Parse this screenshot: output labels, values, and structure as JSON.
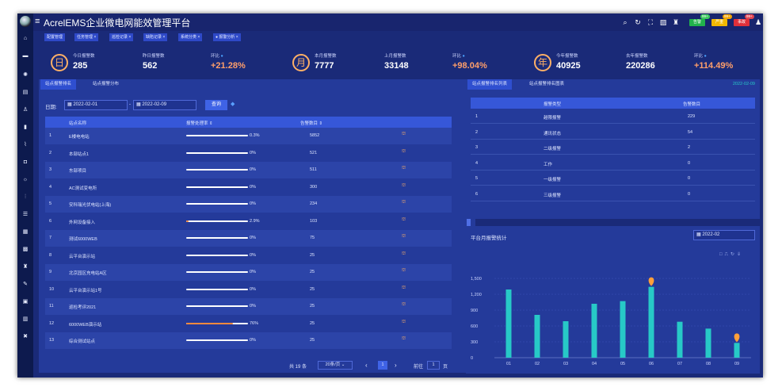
{
  "app": {
    "title": "AcrelEMS企业微电网能效管理平台"
  },
  "topbar": {
    "badges": [
      {
        "label": "告警",
        "count": "99+",
        "color": "#22b24c",
        "count_color": "#3cc85c"
      },
      {
        "label": "严重",
        "count": "99+",
        "color": "#f2b800",
        "count_color": "#f2a400"
      },
      {
        "label": "事故",
        "count": "99+",
        "color": "#e0303a",
        "count_color": "#e04450"
      }
    ],
    "icons": [
      "search-icon",
      "refresh-icon",
      "fullscreen-icon",
      "image-icon",
      "shirt-icon",
      "user-icon"
    ]
  },
  "nav_tabs": [
    "配置管理",
    "任务管理 ×",
    "巡检记录 ×",
    "缺陷记录 ×",
    "系统分类 ×",
    "● 报警分析 ×"
  ],
  "kpis": [
    {
      "circle": "日",
      "today_label": "今日报警数",
      "today_value": "285",
      "prev_label": "昨日报警数",
      "prev_value": "562",
      "ratio_label": "环比",
      "ratio_value": "+21.28%"
    },
    {
      "circle": "月",
      "today_label": "本月报警数",
      "today_value": "7777",
      "prev_label": "上月报警数",
      "prev_value": "33148",
      "ratio_label": "环比",
      "ratio_value": "+98.04%"
    },
    {
      "circle": "年",
      "today_label": "今年报警数",
      "today_value": "40925",
      "prev_label": "去年报警数",
      "prev_value": "220286",
      "ratio_label": "环比",
      "ratio_value": "+114.49%"
    }
  ],
  "left_panel": {
    "tabs": [
      "站点报警排名",
      "站点报警分布"
    ],
    "date_label": "日期:",
    "date_from": "2022-02-01",
    "date_sep": "-",
    "date_to": "2022-02-09",
    "query_label": "查询",
    "columns": [
      "站点名称",
      "报警处理率 ⇕",
      "告警数目 ⇕",
      ""
    ],
    "rows": [
      {
        "no": "1",
        "name": "E楼电电站",
        "rate_text": "0.3%",
        "rate": 0.997,
        "orange": false,
        "count": "5852"
      },
      {
        "no": "2",
        "name": "本部站点1",
        "rate_text": "0%",
        "rate": 1.0,
        "orange": false,
        "count": "521"
      },
      {
        "no": "3",
        "name": "东部项目",
        "rate_text": "0%",
        "rate": 1.0,
        "orange": false,
        "count": "511"
      },
      {
        "no": "4",
        "name": "AC测试变电所",
        "rate_text": "0%",
        "rate": 1.0,
        "orange": false,
        "count": "300"
      },
      {
        "no": "5",
        "name": "安科瑞光伏电站(上海)",
        "rate_text": "0%",
        "rate": 1.0,
        "orange": false,
        "count": "234"
      },
      {
        "no": "6",
        "name": "外网设备接入",
        "rate_text": "2.9%",
        "rate": 0.029,
        "orange": true,
        "count": "103"
      },
      {
        "no": "7",
        "name": "测试6000WEB",
        "rate_text": "0%",
        "rate": 1.0,
        "orange": false,
        "count": "75"
      },
      {
        "no": "8",
        "name": "云平台演示站",
        "rate_text": "0%",
        "rate": 1.0,
        "orange": false,
        "count": "25"
      },
      {
        "no": "9",
        "name": "北京园区充电站A区",
        "rate_text": "0%",
        "rate": 1.0,
        "orange": false,
        "count": "25"
      },
      {
        "no": "10",
        "name": "云平台演示站1号",
        "rate_text": "0%",
        "rate": 1.0,
        "orange": false,
        "count": "25"
      },
      {
        "no": "11",
        "name": "巡检考评2021",
        "rate_text": "0%",
        "rate": 1.0,
        "orange": false,
        "count": "25"
      },
      {
        "no": "12",
        "name": "6000WEB演示站",
        "rate_text": "76%",
        "rate": 0.76,
        "orange": true,
        "count": "25"
      },
      {
        "no": "13",
        "name": "综合测试站点",
        "rate_text": "0%",
        "rate": 1.0,
        "orange": false,
        "count": "25"
      }
    ],
    "pagination": {
      "total": "共 19 条",
      "page_size": "20条/页 ⌄",
      "prev": "‹",
      "current": "1",
      "next": "›",
      "goto_label": "前往",
      "goto_value": "1",
      "goto_suffix": "页"
    }
  },
  "right_top": {
    "tabs": [
      "站点报警排名列表",
      "站点报警排名图表"
    ],
    "date": "2022-02-09",
    "columns": [
      "报警类型",
      "告警数目"
    ],
    "rows": [
      {
        "no": "1",
        "type": "越限报警",
        "count": "229"
      },
      {
        "no": "2",
        "type": "通讯状态",
        "count": "54"
      },
      {
        "no": "3",
        "type": "二级报警",
        "count": "2"
      },
      {
        "no": "4",
        "type": "工作",
        "count": "0"
      },
      {
        "no": "5",
        "type": "一级报警",
        "count": "0"
      },
      {
        "no": "6",
        "type": "三级报警",
        "count": "0"
      }
    ]
  },
  "right_chart": {
    "title": "平台月报警统计",
    "month": "2022-02",
    "toolbox": [
      "□",
      "⎍",
      "↻",
      "⇓"
    ]
  },
  "chart_data": {
    "type": "bar",
    "categories": [
      "01",
      "02",
      "03",
      "04",
      "05",
      "06",
      "07",
      "08",
      "09"
    ],
    "values": [
      1290,
      810,
      690,
      1020,
      1070,
      1340,
      680,
      550,
      280
    ],
    "ylim": [
      0,
      1500
    ],
    "yticks": [
      "0",
      "300",
      "600",
      "900",
      "1,200",
      "1,500"
    ],
    "markers": [
      {
        "index": 5,
        "type": "max"
      },
      {
        "index": 8,
        "type": "min"
      }
    ],
    "bar_color": "#27c9c7",
    "marker_color": "#ff9f3a"
  }
}
